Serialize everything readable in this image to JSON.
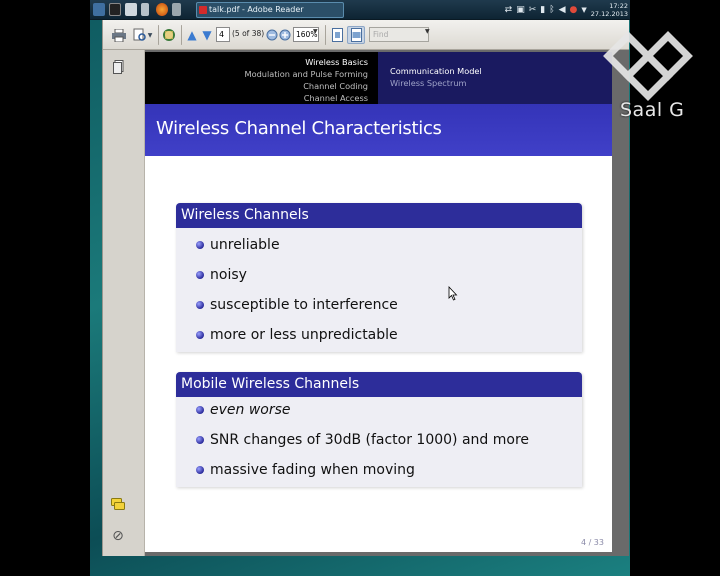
{
  "taskbar": {
    "window_label": "talk.pdf - Adobe Reader",
    "clock_time": "17:22",
    "clock_date": "27.12.2013"
  },
  "toolbar": {
    "page_value": "4",
    "page_of": "(5 of 38)",
    "zoom_value": "160%",
    "find_placeholder": "Find"
  },
  "slide": {
    "nav_left": [
      "Wireless Basics",
      "Modulation and Pulse Forming",
      "Channel Coding",
      "Channel Access"
    ],
    "nav_right": [
      "Communication Model",
      "Wireless Spectrum"
    ],
    "title": "Wireless Channel Characteristics",
    "blocks": [
      {
        "heading": "Wireless Channels",
        "items": [
          "unreliable",
          "noisy",
          "susceptible to interference",
          "more or less unpredictable"
        ]
      },
      {
        "heading": "Mobile Wireless Channels",
        "items": [
          "even worse",
          "SNR changes of 30dB (factor 1000) and more",
          "massive fading when moving"
        ]
      }
    ],
    "page_number": "4 / 33"
  },
  "watermark": {
    "text": "Saal G"
  },
  "colors": {
    "title_bar": "#3a3ac0",
    "block_head": "#2d2d9a",
    "header_black": "#000000",
    "header_navy": "#1a1a60"
  }
}
